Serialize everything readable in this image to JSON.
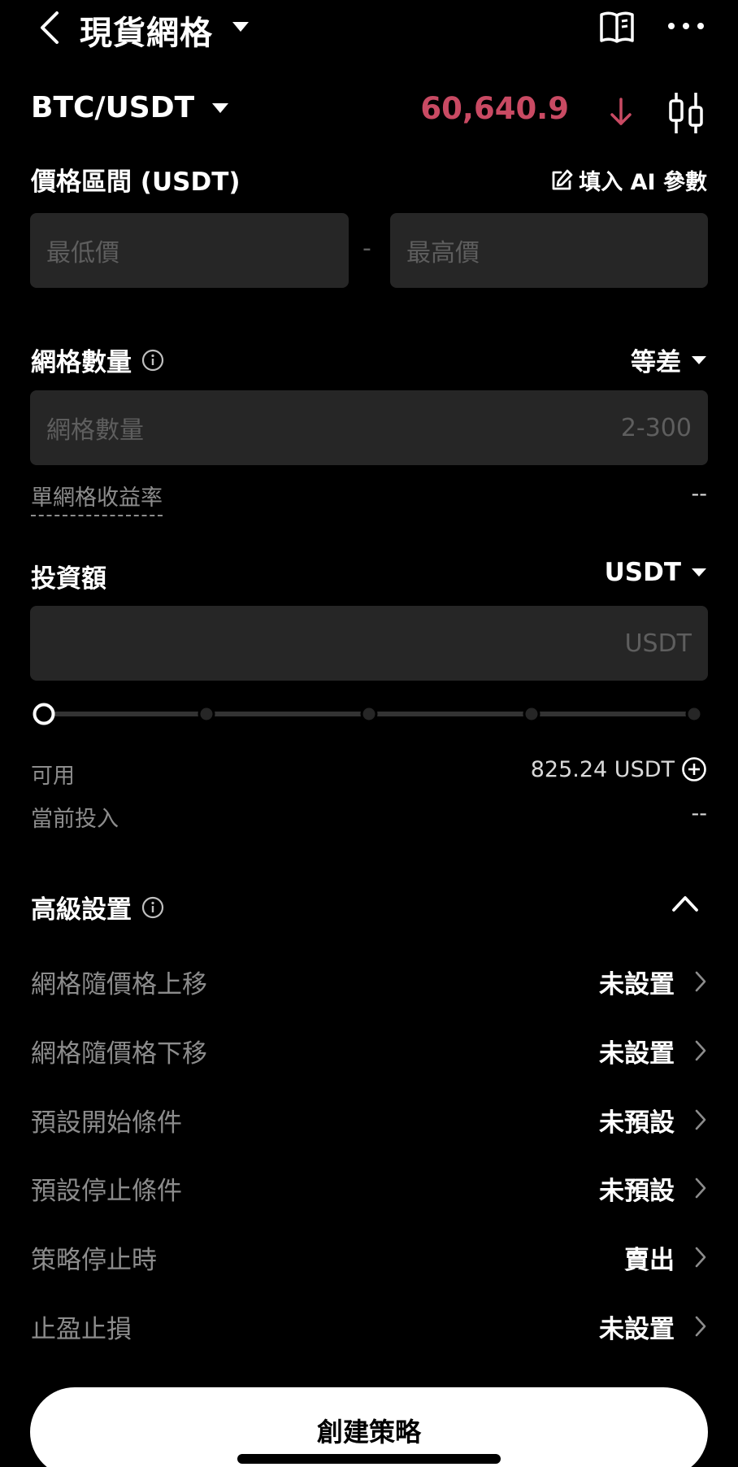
{
  "header": {
    "title": "現貨網格",
    "icons": {
      "back": "chevron-left-icon",
      "caret": "caret-down-icon",
      "guide": "book-icon",
      "more": "more-dots-icon"
    }
  },
  "pair": {
    "symbol": "BTC/USDT",
    "price": "60,640.9",
    "price_color": "#c94a63",
    "trend": "down"
  },
  "price_range": {
    "label": "價格區間 (USDT)",
    "ai_fill_label": "填入 AI 參數",
    "min_placeholder": "最低價",
    "max_placeholder": "最高價",
    "separator": "-"
  },
  "grid": {
    "label": "網格數量",
    "mode": "等差",
    "placeholder": "網格數量",
    "range_hint": "2-300",
    "yield_label": "單網格收益率",
    "yield_value": "--"
  },
  "investment": {
    "label": "投資額",
    "currency": "USDT",
    "unit_hint": "USDT",
    "slider_level": 0,
    "available_label": "可用",
    "available_value": "825.24 USDT",
    "current_label": "當前投入",
    "current_value": "--"
  },
  "advanced": {
    "label": "高級設置",
    "items": [
      {
        "name": "網格隨價格上移",
        "value": "未設置"
      },
      {
        "name": "網格隨價格下移",
        "value": "未設置"
      },
      {
        "name": "預設開始條件",
        "value": "未預設"
      },
      {
        "name": "預設停止條件",
        "value": "未預設"
      },
      {
        "name": "策略停止時",
        "value": "賣出"
      },
      {
        "name": "止盈止損",
        "value": "未設置"
      }
    ]
  },
  "actions": {
    "create_label": "創建策略"
  }
}
